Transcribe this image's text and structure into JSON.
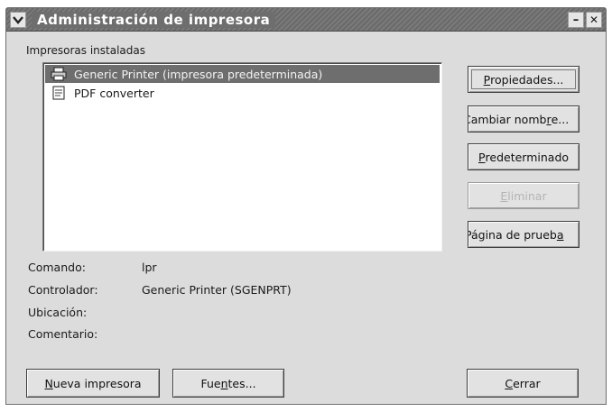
{
  "window": {
    "title": "Administración de impresora",
    "minimize_glyph": "–",
    "close_glyph": "✕"
  },
  "installed": {
    "label": "Impresoras instaladas",
    "printers": [
      {
        "name": "Generic Printer (impresora predeterminada)",
        "selected": true,
        "icon": "printer-icon"
      },
      {
        "name": "PDF converter",
        "selected": false,
        "icon": "pdf-document-icon"
      }
    ]
  },
  "side_buttons": {
    "properties": {
      "underline": "P",
      "rest": "ropiedades..."
    },
    "rename": {
      "pre": "Cambiar nomb",
      "underline": "r",
      "rest": "e..."
    },
    "default": {
      "underline": "P",
      "rest": "redeterminado"
    },
    "delete": {
      "pre": "",
      "underline": "E",
      "rest": "liminar"
    },
    "test_page": {
      "pre": "Página de prueb",
      "underline": "a",
      "rest": ""
    }
  },
  "info": {
    "command_label": "Comando:",
    "command_value": "lpr",
    "driver_label": "Controlador:",
    "driver_value": "Generic Printer (SGENPRT)",
    "location_label": "Ubicación:",
    "location_value": "",
    "comment_label": "Comentario:",
    "comment_value": ""
  },
  "bottom_buttons": {
    "new_printer": {
      "underline": "N",
      "rest": "ueva impresora"
    },
    "fonts": {
      "pre": "Fue",
      "underline": "n",
      "rest": "tes..."
    },
    "close": {
      "underline": "C",
      "rest": "errar"
    }
  }
}
